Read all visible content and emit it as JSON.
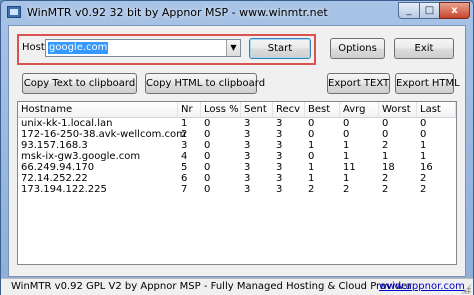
{
  "window": {
    "title": "WinMTR v0.92 32 bit by Appnor MSP - www.winmtr.net",
    "minimize_glyph": "_",
    "maximize_glyph": "□",
    "close_glyph": "x"
  },
  "host": {
    "label": "Host:",
    "value": "google.com",
    "dropdown_icon": "▼"
  },
  "buttons": {
    "start": "Start",
    "options": "Options",
    "exit": "Exit",
    "copy_text": "Copy Text to clipboard",
    "copy_html": "Copy HTML to clipboard",
    "export_text": "Export TEXT",
    "export_html": "Export HTML"
  },
  "table": {
    "columns": [
      "Hostname",
      "Nr",
      "Loss %",
      "Sent",
      "Recv",
      "Best",
      "Avrg",
      "Worst",
      "Last"
    ],
    "rows": [
      [
        "unix-kk-1.local.lan",
        "1",
        "0",
        "3",
        "3",
        "0",
        "0",
        "0",
        "0"
      ],
      [
        "172-16-250-38.avk-wellcom.com",
        "2",
        "0",
        "3",
        "3",
        "0",
        "0",
        "0",
        "0"
      ],
      [
        "93.157.168.3",
        "3",
        "0",
        "3",
        "3",
        "1",
        "1",
        "2",
        "1"
      ],
      [
        "msk-ix-gw3.google.com",
        "4",
        "0",
        "3",
        "3",
        "0",
        "1",
        "1",
        "1"
      ],
      [
        "66.249.94.170",
        "5",
        "0",
        "3",
        "3",
        "1",
        "11",
        "18",
        "16"
      ],
      [
        "72.14.252.22",
        "6",
        "0",
        "3",
        "3",
        "1",
        "1",
        "2",
        "2"
      ],
      [
        "173.194.122.225",
        "7",
        "0",
        "3",
        "3",
        "2",
        "2",
        "2",
        "2"
      ]
    ]
  },
  "status": {
    "text": "WinMTR v0.92 GPL V2 by Appnor MSP - Fully Managed Hosting & Cloud Provider",
    "link": "www.appnor.com"
  },
  "colors": {
    "highlight_border": "#d9534f",
    "selection": "#3399ff",
    "link": "#0000cc"
  }
}
